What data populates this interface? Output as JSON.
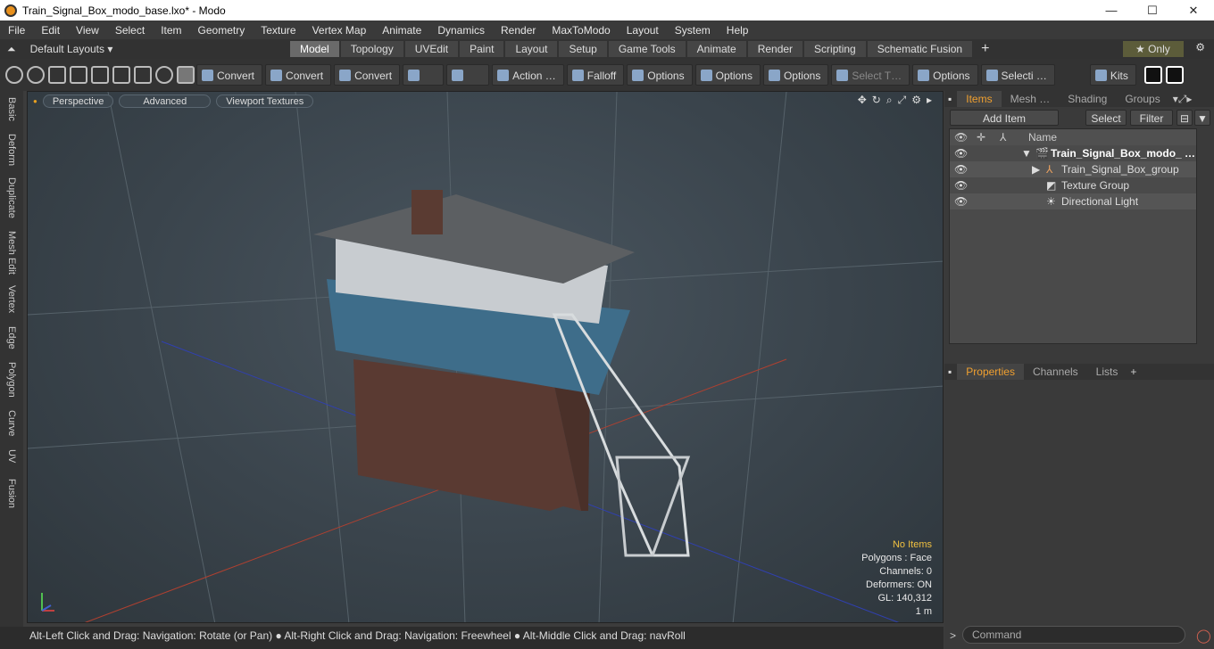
{
  "window": {
    "title": "Train_Signal_Box_modo_base.lxo* - Modo",
    "minimize": "—",
    "maximize": "☐",
    "close": "✕"
  },
  "menu": [
    "File",
    "Edit",
    "View",
    "Select",
    "Item",
    "Geometry",
    "Texture",
    "Vertex Map",
    "Animate",
    "Dynamics",
    "Render",
    "MaxToModo",
    "Layout",
    "System",
    "Help"
  ],
  "layouts": {
    "label": "Default Layouts ▾"
  },
  "layout_tabs": [
    "Model",
    "Topology",
    "UVEdit",
    "Paint",
    "Layout",
    "Setup",
    "Game Tools",
    "Animate",
    "Render",
    "Scripting",
    "Schematic Fusion"
  ],
  "active_layout_tab": "Model",
  "only_label": "★  Only",
  "toolbar": {
    "convert1": "Convert",
    "convert2": "Convert",
    "convert3": "Convert",
    "action": "Action …",
    "falloff": "Falloff",
    "options1": "Options",
    "options2": "Options",
    "options3": "Options",
    "select_t": "Select T…",
    "options4": "Options",
    "selecti": "Selecti …",
    "kits": "Kits"
  },
  "left_tabs": [
    "Basic",
    "Deform",
    "Duplicate",
    "Mesh Edit",
    "Vertex",
    "Edge",
    "Polygon",
    "Curve",
    "UV",
    "Fusion"
  ],
  "viewport": {
    "perspective": "Perspective",
    "advanced": "Advanced",
    "textures": "Viewport Textures",
    "hud": {
      "no_items": "No Items",
      "polygons": "Polygons : Face",
      "channels": "Channels: 0",
      "deformers": "Deformers: ON",
      "gl": "GL: 140,312",
      "unit": "1 m"
    }
  },
  "status": "Alt-Left Click and Drag: Navigation: Rotate (or Pan) ● Alt-Right Click and Drag: Navigation: Freewheel ● Alt-Middle Click and Drag: navRoll",
  "items_panel": {
    "tabs": [
      "Items",
      "Mesh …",
      "Shading",
      "Groups"
    ],
    "add_item": "Add Item",
    "select": "Select",
    "filter": "Filter",
    "column_name": "Name",
    "rows": [
      {
        "label": "Train_Signal_Box_modo_ …",
        "bold": true
      },
      {
        "label": "Train_Signal_Box_group"
      },
      {
        "label": "Texture Group"
      },
      {
        "label": "Directional Light"
      }
    ]
  },
  "props_panel": {
    "tabs": [
      "Properties",
      "Channels",
      "Lists"
    ]
  },
  "command": {
    "placeholder": "Command"
  }
}
